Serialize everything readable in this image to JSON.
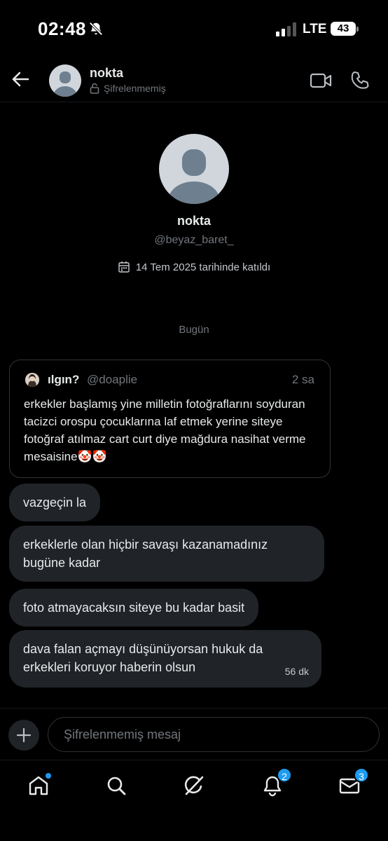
{
  "status_bar": {
    "time": "02:48",
    "network": "LTE",
    "battery": "43"
  },
  "header": {
    "name": "nokta",
    "encryption": "Şifrelenmemiş"
  },
  "profile": {
    "name": "nokta",
    "handle": "@beyaz_baret_",
    "joined": "14 Tem 2025 tarihinde katıldı"
  },
  "day_separator": "Bugün",
  "quote": {
    "name": "ılgın?",
    "handle": "@doaplie",
    "time": "2 sa",
    "text": "erkekler başlamış yine milletin fotoğraflarını soyduran tacizci orospu çocuklarına laf etmek yerine siteye fotoğraf atılmaz cart curt diye mağdura nasihat verme mesaisine🤡🤡"
  },
  "messages": [
    {
      "text": "vazgeçin la"
    },
    {
      "text": "erkeklerle olan hiçbir savaşı kazanamadınız bugüne kadar"
    },
    {
      "text": "foto atmayacaksın siteye bu kadar basit"
    },
    {
      "text": "dava falan açmayı düşünüyorsan hukuk da erkekleri koruyor haberin olsun",
      "time": "56 dk"
    }
  ],
  "composer": {
    "placeholder": "Şifrelenmemiş mesaj"
  },
  "tabbar": {
    "notifications_badge": "2",
    "messages_badge": "3"
  },
  "colors": {
    "accent": "#1d9bf0",
    "bubble": "#202327",
    "muted": "#71767b"
  }
}
